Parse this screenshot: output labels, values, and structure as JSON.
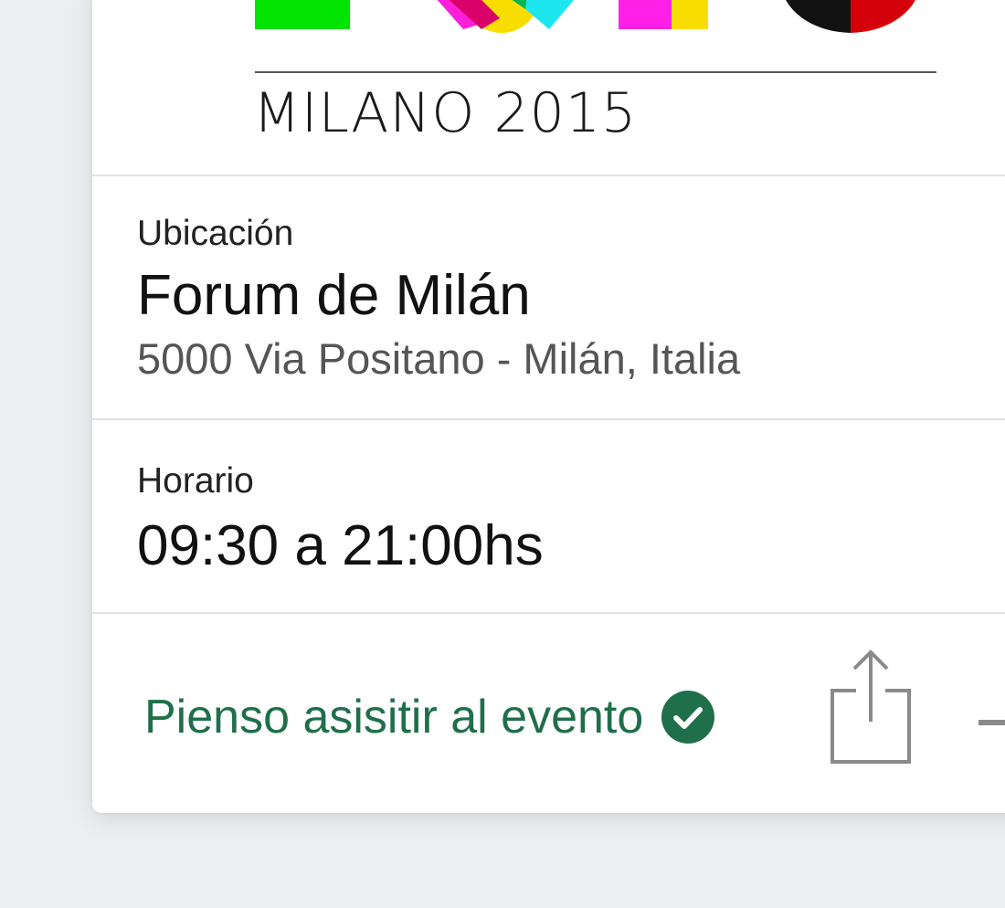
{
  "event_card": {
    "logo": {
      "text": "MILANO 2015"
    },
    "location": {
      "label": "Ubicación",
      "venue": "Forum de Milán",
      "address": "5000 Via Positano - Milán, Italia"
    },
    "schedule": {
      "label": "Horario",
      "hours": "09:30 a 21:00hs"
    },
    "actions": {
      "attend_label": "Pienso asisitir al evento",
      "attend_icon": "check-circle-icon",
      "share_icon": "share-icon"
    }
  },
  "colors": {
    "accent_green": "#1f6f4a",
    "background": "#eceef1",
    "card": "#ffffff"
  }
}
